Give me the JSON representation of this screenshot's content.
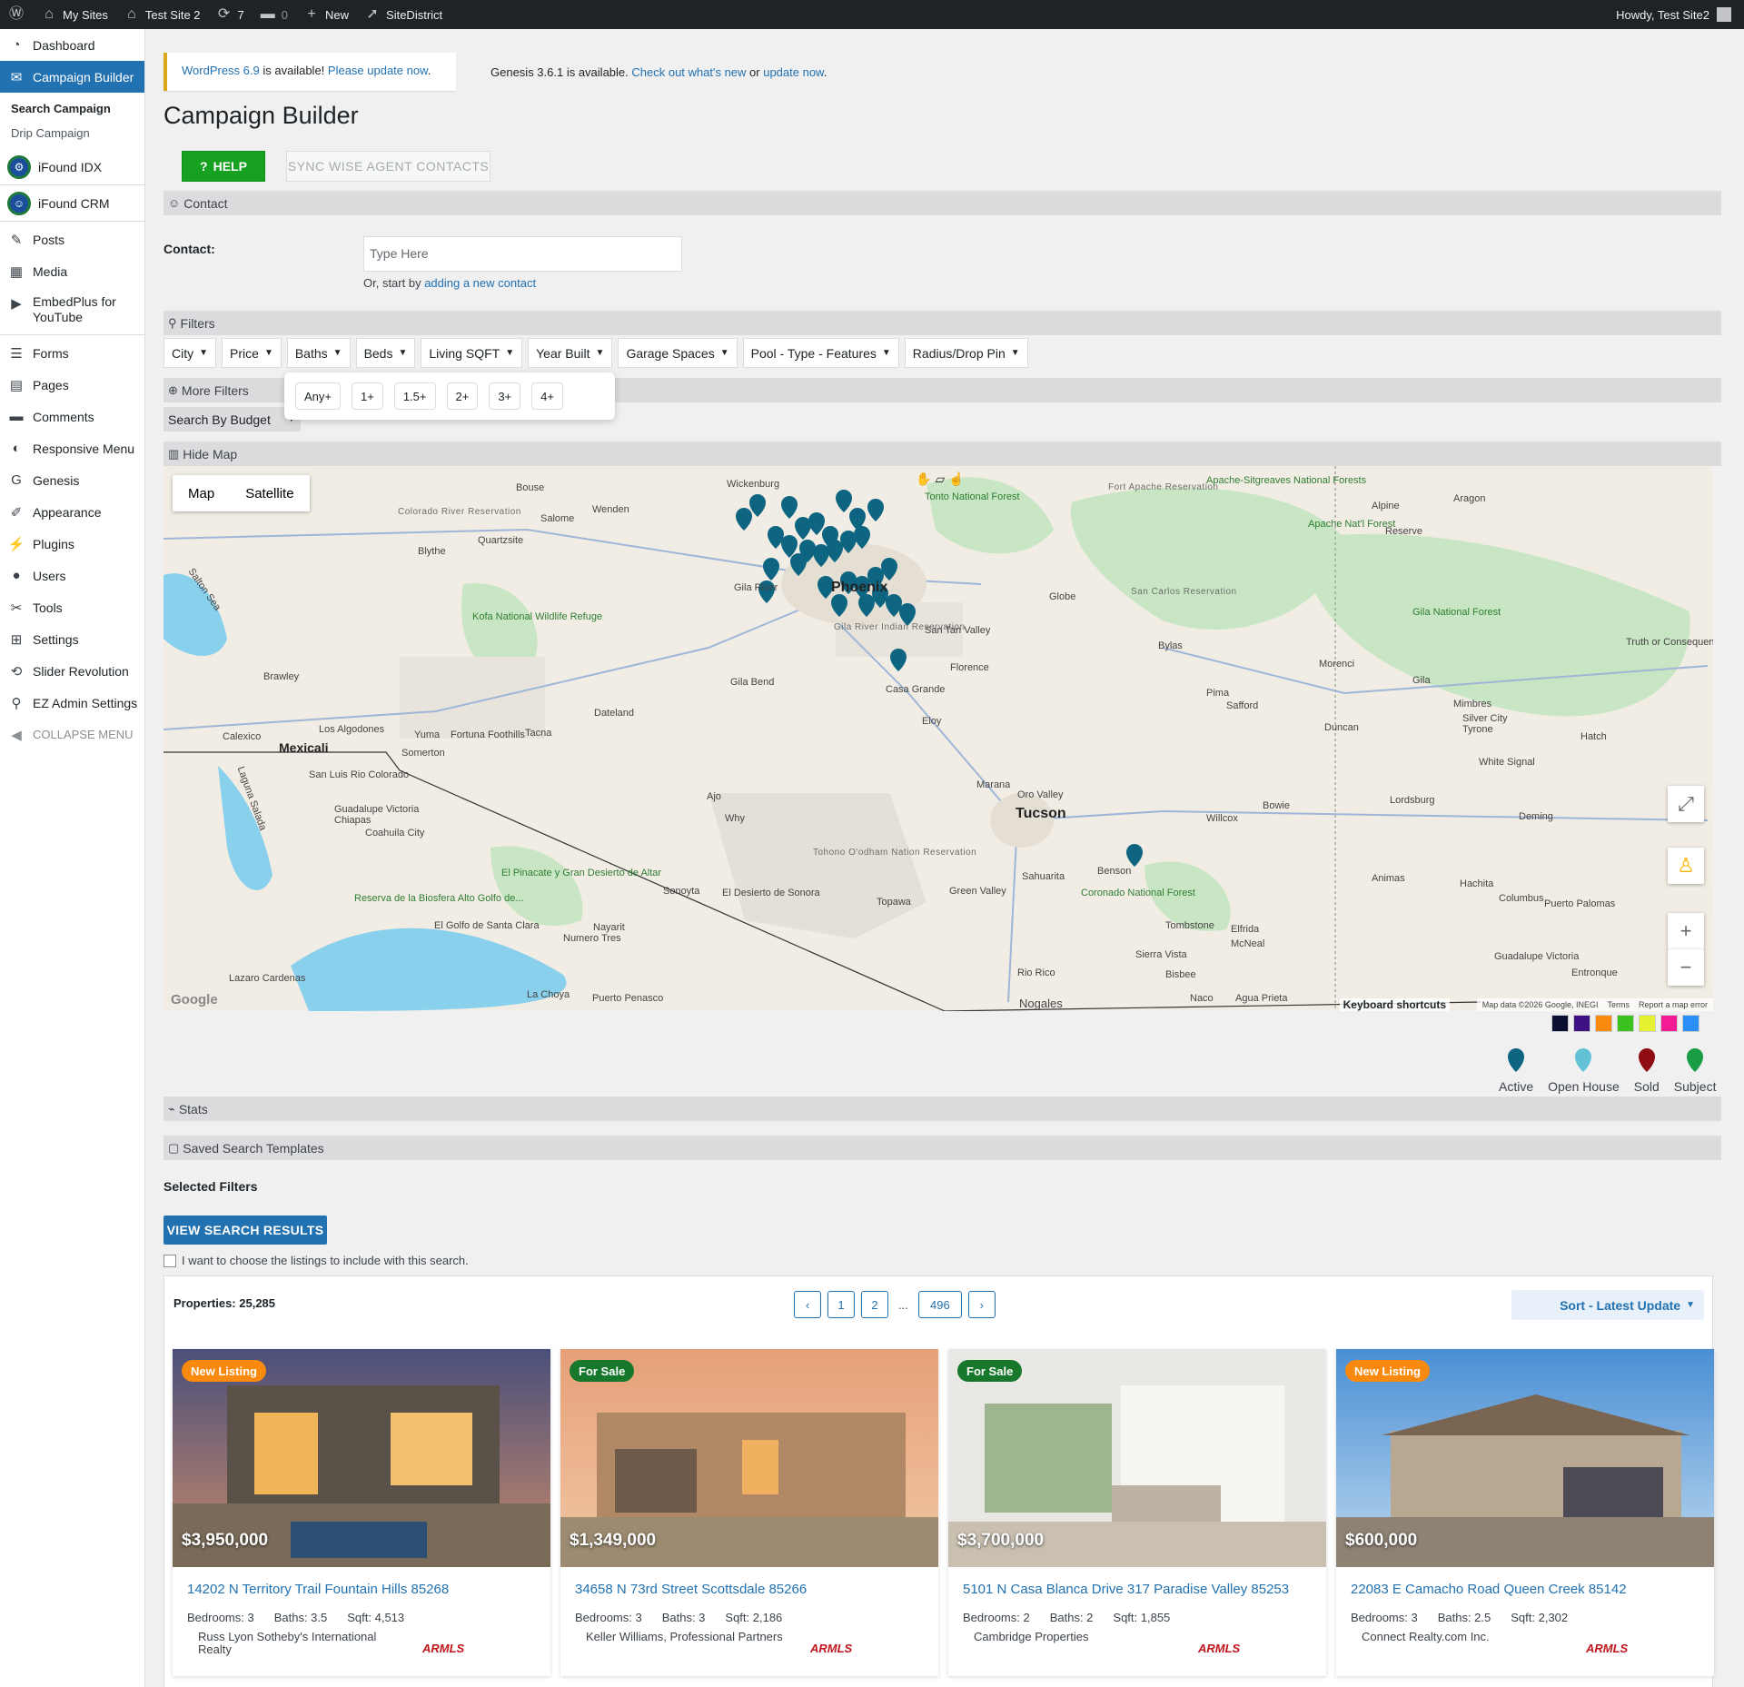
{
  "adminbar": {
    "my_sites": "My Sites",
    "site_name": "Test Site 2",
    "updates": "7",
    "comments": "0",
    "new": "New",
    "plugin_link": "SiteDistrict",
    "howdy": "Howdy, Test Site2"
  },
  "sidebar": {
    "items": [
      {
        "label": "Dashboard",
        "icon": "dashboard-icon"
      },
      {
        "label": "Campaign Builder",
        "icon": "envelope-icon"
      },
      {
        "label": "iFound IDX",
        "icon": "ifound-idx-icon"
      },
      {
        "label": "iFound CRM",
        "icon": "ifound-crm-icon"
      },
      {
        "label": "Posts",
        "icon": "pin-icon"
      },
      {
        "label": "Media",
        "icon": "media-icon"
      },
      {
        "label": "EmbedPlus for YouTube",
        "icon": "youtube-icon"
      },
      {
        "label": "Forms",
        "icon": "forms-icon"
      },
      {
        "label": "Pages",
        "icon": "pages-icon"
      },
      {
        "label": "Comments",
        "icon": "comments-icon"
      },
      {
        "label": "Responsive Menu",
        "icon": "responsive-menu-icon"
      },
      {
        "label": "Genesis",
        "icon": "genesis-icon"
      },
      {
        "label": "Appearance",
        "icon": "appearance-icon"
      },
      {
        "label": "Plugins",
        "icon": "plugins-icon"
      },
      {
        "label": "Users",
        "icon": "users-icon"
      },
      {
        "label": "Tools",
        "icon": "tools-icon"
      },
      {
        "label": "Settings",
        "icon": "settings-icon"
      },
      {
        "label": "Slider Revolution",
        "icon": "slider-icon"
      },
      {
        "label": "EZ Admin Settings",
        "icon": "location-icon"
      },
      {
        "label": "COLLAPSE MENU",
        "icon": "collapse-icon"
      }
    ],
    "submenu": [
      "Search Campaign",
      "Drip Campaign"
    ]
  },
  "notice": {
    "wp_link": "WordPress 6.9",
    "wp_text": " is available! ",
    "wp_update": "Please update now",
    "genesis_text": "Genesis 3.6.1 is available. ",
    "genesis_link": "Check out what's new",
    "genesis_or": " or ",
    "genesis_update": "update now"
  },
  "page": {
    "title": "Campaign Builder",
    "help_label": "HELP",
    "sync_label": "SYNC WISE AGENT CONTACTS"
  },
  "contact": {
    "section": "Contact",
    "label": "Contact:",
    "placeholder": "Type Here",
    "help_prefix": "Or, start by ",
    "help_link": "adding a new contact"
  },
  "filters": {
    "section": "Filters",
    "buttons": [
      "City",
      "Price",
      "Baths",
      "Beds",
      "Living SQFT",
      "Year Built",
      "Garage Spaces",
      "Pool - Type - Features",
      "Radius/Drop Pin"
    ],
    "more": "More Filters",
    "budget": "Search By Budget",
    "baths_options": [
      "Any+",
      "1+",
      "1.5+",
      "2+",
      "3+",
      "4+"
    ]
  },
  "map": {
    "hide": "Hide Map",
    "toggle_map": "Map",
    "toggle_sat": "Satellite",
    "keyboard": "Keyboard shortcuts",
    "footer": [
      "Map data ©2026 Google, INEGI",
      "Terms",
      "Report a map error"
    ],
    "google": "Google",
    "places": [
      "Wickenburg",
      "Bouse",
      "Salome",
      "Wenden",
      "Quartzsite",
      "Blythe",
      "Tonto National Forest",
      "Fort Apache Reservation",
      "Apache-Sitgreaves National Forests",
      "Alpine",
      "Aragon",
      "Apache Nat'l Forest",
      "Reserve",
      "Colorado River Reservation",
      "Salton Sea",
      "Kofa National Wildlife Refuge",
      "Phoenix",
      "Gila River",
      "Gila River Indian Reservation",
      "San Tan Valley",
      "Globe",
      "San Carlos Reservation",
      "Gila National Forest",
      "Truth or Consequences",
      "Brawley",
      "Gila Bend",
      "Florence",
      "Bylas",
      "Morenci",
      "Casa Grande",
      "Pima",
      "Safford",
      "Gila",
      "Mimbres",
      "Dateland",
      "Eloy",
      "Duncan",
      "Silver City",
      "Tyrone",
      "Hatch",
      "Calexico",
      "Mexicali",
      "Los Algodones",
      "Yuma",
      "Fortuna Foothills",
      "Tacna",
      "Somerton",
      "San Luis Rio Colorado",
      "Marana",
      "Oro Valley",
      "White Signal",
      "Tucson",
      "Lordsburg",
      "Ajo",
      "Why",
      "Bowie",
      "Willcox",
      "Deming",
      "Guadalupe Victoria",
      "Chiapas",
      "Coahuila City",
      "Tohono O'odham Nation Reservation",
      "Sahuarita",
      "Benson",
      "Animas",
      "Hachita",
      "El Pinacate y Gran Desierto de Altar",
      "Sonoyta",
      "El Desierto de Sonora",
      "Topawa",
      "Green Valley",
      "Coronado National Forest",
      "Columbus",
      "Puerto Palomas",
      "Reserva de la Biosfera Alto Golfo de...",
      "El Golfo de Santa Clara",
      "Nayarit",
      "Numero Tres",
      "Tombstone",
      "Elfrida",
      "McNeal",
      "Sierra Vista",
      "Rio Rico",
      "Bisbee",
      "Lazaro Cardenas",
      "La Choya",
      "Puerto Penasco",
      "Nogales",
      "Naco",
      "Agua Prieta",
      "Entronque",
      "Guadalupe Victoria",
      "Laguna Salada"
    ]
  },
  "colors": [
    "#0b1033",
    "#3f1283",
    "#f98a0e",
    "#3bc21f",
    "#e6f231",
    "#f41c95",
    "#2a8ff7"
  ],
  "legend": [
    {
      "label": "Active",
      "color": "#0e6582"
    },
    {
      "label": "Open House",
      "color": "#63c1d6"
    },
    {
      "label": "Sold",
      "color": "#8e0c12"
    },
    {
      "label": "Subject",
      "color": "#1a9c45"
    }
  ],
  "stats": {
    "section": "Stats"
  },
  "templates": {
    "section": "Saved Search Templates"
  },
  "selected": {
    "title": "Selected Filters",
    "view_button": "VIEW SEARCH RESULTS",
    "checkbox_label": "I want to choose the listings to include with this search."
  },
  "results": {
    "properties": "Properties: 25,285",
    "pages": [
      "1",
      "2",
      "496"
    ],
    "dots": "...",
    "sort": "Sort - Latest Update",
    "listings": [
      {
        "badge": "New Listing",
        "badge_color": "#f98a0e",
        "price": "$3,950,000",
        "address": "14202 N Territory Trail Fountain Hills 85268",
        "beds": "Bedrooms: 3",
        "baths": "Baths: 3.5",
        "sqft": "Sqft: 4,513",
        "broker": "Russ Lyon Sotheby's International Realty",
        "mls": "ARMLS"
      },
      {
        "badge": "For Sale",
        "badge_color": "#17782c",
        "price": "$1,349,000",
        "address": "34658 N 73rd Street Scottsdale 85266",
        "beds": "Bedrooms: 3",
        "baths": "Baths: 3",
        "sqft": "Sqft: 2,186",
        "broker": "Keller Williams, Professional Partners",
        "mls": "ARMLS"
      },
      {
        "badge": "For Sale",
        "badge_color": "#17782c",
        "price": "$3,700,000",
        "address": "5101 N Casa Blanca Drive 317 Paradise Valley 85253",
        "beds": "Bedrooms: 2",
        "baths": "Baths: 2",
        "sqft": "Sqft: 1,855",
        "broker": "Cambridge Properties",
        "mls": "ARMLS"
      },
      {
        "badge": "New Listing",
        "badge_color": "#f98a0e",
        "price": "$600,000",
        "address": "22083 E Camacho Road Queen Creek 85142",
        "beds": "Bedrooms: 3",
        "baths": "Baths: 2.5",
        "sqft": "Sqft: 2,302",
        "broker": "Connect Realty.com Inc.",
        "mls": "ARMLS"
      }
    ]
  }
}
